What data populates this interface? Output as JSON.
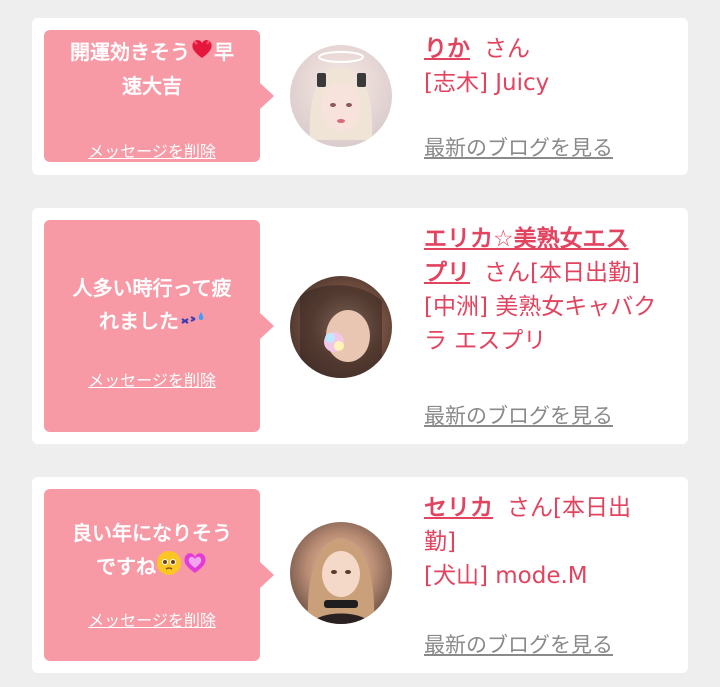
{
  "colors": {
    "bubble": "#f79aa5",
    "accent": "#e2435f",
    "link_gray": "#8a8a8a",
    "bg": "#eeeeee",
    "card": "#ffffff"
  },
  "cards": [
    {
      "message": "開運効きそう❤️早速大吉",
      "message_line1": "開運効きそう",
      "message_line1b": "早",
      "message_line2": "速大吉",
      "emoji": "heart-with-sparks-icon",
      "delete_label": "メッセージを削除",
      "name": "りか",
      "suffix": "さん",
      "shop": "[志木] Juicy",
      "blog_label": "最新のブログを見る"
    },
    {
      "message_line1": "人多い時行って疲",
      "message_line2": "れました",
      "emoji": "sweat-smile-icon",
      "delete_label": "メッセージを削除",
      "name_line1": "エリカ☆美熟女エス",
      "name_line2": "プリ",
      "suffix": "さん[本日出勤]",
      "shop_line1": "[中洲] 美熟女キャバク",
      "shop_line2": "ラ エスプリ",
      "blog_label": "最新のブログを見る"
    },
    {
      "message_line1": "良い年になりそう",
      "message_line2": "ですね",
      "emoji": "pleading-face-pink-heart-icon",
      "delete_label": "メッセージを削除",
      "name": "セリカ",
      "suffix_line1": "さん[本日出",
      "suffix_line2": "勤]",
      "shop": "[犬山] mode.M",
      "blog_label": "最新のブログを見る"
    }
  ]
}
